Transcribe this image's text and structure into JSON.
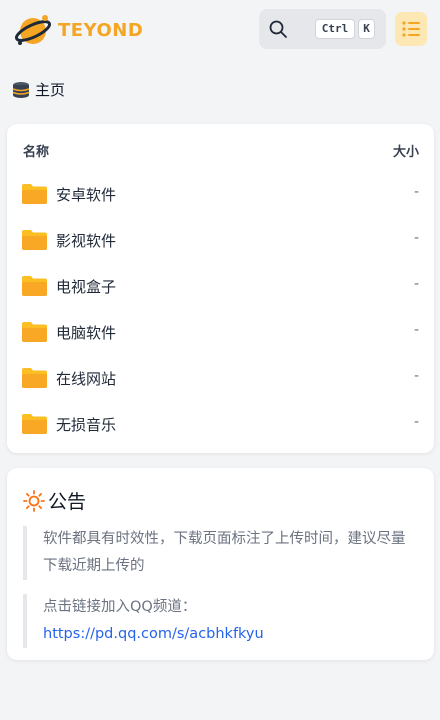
{
  "header": {
    "brand": "TEYOND",
    "search": {
      "key_ctrl": "Ctrl",
      "key_k": "K"
    }
  },
  "breadcrumb": {
    "label": "主页"
  },
  "files": {
    "col_name": "名称",
    "col_size": "大小",
    "rows": [
      {
        "name": "安卓软件",
        "size": "-"
      },
      {
        "name": "影视软件",
        "size": "-"
      },
      {
        "name": "电视盒子",
        "size": "-"
      },
      {
        "name": "电脑软件",
        "size": "-"
      },
      {
        "name": "在线网站",
        "size": "-"
      },
      {
        "name": "无损音乐",
        "size": "-"
      }
    ]
  },
  "notice": {
    "title": "公告",
    "text1": "软件都具有时效性，下载页面标注了上传时间，建议尽量下载近期上传的",
    "text2": "点击链接加入QQ频道：",
    "link": "https://pd.qq.com/s/acbhkfkyu"
  },
  "colors": {
    "accent": "#f5a524",
    "folder": "#fbbf24",
    "link": "#2563eb",
    "background": "#f3f4f6"
  }
}
